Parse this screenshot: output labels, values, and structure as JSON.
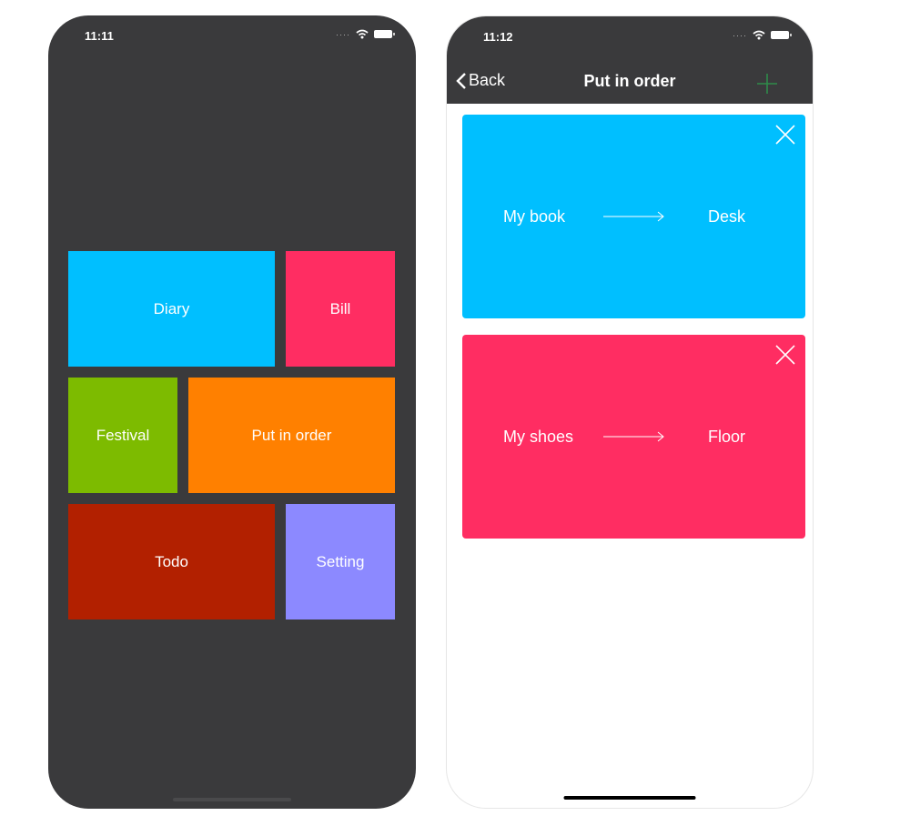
{
  "left_screen": {
    "status": {
      "time": "11:11"
    },
    "tiles": [
      {
        "label": "Diary",
        "color": "#00bfff"
      },
      {
        "label": "Bill",
        "color": "#ff2d62"
      },
      {
        "label": "Festival",
        "color": "#7dbb00"
      },
      {
        "label": "Put in order",
        "color": "#ff8000"
      },
      {
        "label": "Todo",
        "color": "#b22000"
      },
      {
        "label": "Setting",
        "color": "#8c89ff"
      }
    ]
  },
  "right_screen": {
    "status": {
      "time": "11:12"
    },
    "nav": {
      "back_label": "Back",
      "title": "Put in order",
      "add_icon": "plus-icon"
    },
    "cards": [
      {
        "from": "My book",
        "to": "Desk",
        "color": "#00bfff"
      },
      {
        "from": "My shoes",
        "to": "Floor",
        "color": "#ff2d62"
      }
    ]
  }
}
